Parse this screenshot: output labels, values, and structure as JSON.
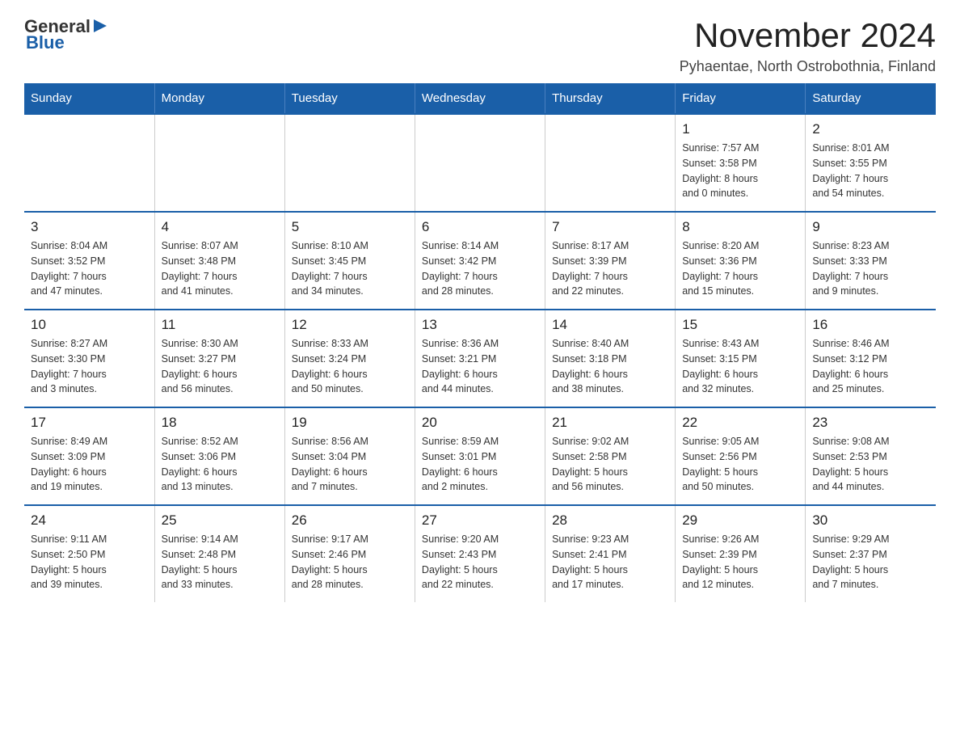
{
  "logo": {
    "text_general": "General",
    "text_blue": "Blue"
  },
  "header": {
    "month_title": "November 2024",
    "location": "Pyhaentae, North Ostrobothnia, Finland"
  },
  "weekdays": [
    "Sunday",
    "Monday",
    "Tuesday",
    "Wednesday",
    "Thursday",
    "Friday",
    "Saturday"
  ],
  "weeks": [
    [
      {
        "day": "",
        "info": ""
      },
      {
        "day": "",
        "info": ""
      },
      {
        "day": "",
        "info": ""
      },
      {
        "day": "",
        "info": ""
      },
      {
        "day": "",
        "info": ""
      },
      {
        "day": "1",
        "info": "Sunrise: 7:57 AM\nSunset: 3:58 PM\nDaylight: 8 hours\nand 0 minutes."
      },
      {
        "day": "2",
        "info": "Sunrise: 8:01 AM\nSunset: 3:55 PM\nDaylight: 7 hours\nand 54 minutes."
      }
    ],
    [
      {
        "day": "3",
        "info": "Sunrise: 8:04 AM\nSunset: 3:52 PM\nDaylight: 7 hours\nand 47 minutes."
      },
      {
        "day": "4",
        "info": "Sunrise: 8:07 AM\nSunset: 3:48 PM\nDaylight: 7 hours\nand 41 minutes."
      },
      {
        "day": "5",
        "info": "Sunrise: 8:10 AM\nSunset: 3:45 PM\nDaylight: 7 hours\nand 34 minutes."
      },
      {
        "day": "6",
        "info": "Sunrise: 8:14 AM\nSunset: 3:42 PM\nDaylight: 7 hours\nand 28 minutes."
      },
      {
        "day": "7",
        "info": "Sunrise: 8:17 AM\nSunset: 3:39 PM\nDaylight: 7 hours\nand 22 minutes."
      },
      {
        "day": "8",
        "info": "Sunrise: 8:20 AM\nSunset: 3:36 PM\nDaylight: 7 hours\nand 15 minutes."
      },
      {
        "day": "9",
        "info": "Sunrise: 8:23 AM\nSunset: 3:33 PM\nDaylight: 7 hours\nand 9 minutes."
      }
    ],
    [
      {
        "day": "10",
        "info": "Sunrise: 8:27 AM\nSunset: 3:30 PM\nDaylight: 7 hours\nand 3 minutes."
      },
      {
        "day": "11",
        "info": "Sunrise: 8:30 AM\nSunset: 3:27 PM\nDaylight: 6 hours\nand 56 minutes."
      },
      {
        "day": "12",
        "info": "Sunrise: 8:33 AM\nSunset: 3:24 PM\nDaylight: 6 hours\nand 50 minutes."
      },
      {
        "day": "13",
        "info": "Sunrise: 8:36 AM\nSunset: 3:21 PM\nDaylight: 6 hours\nand 44 minutes."
      },
      {
        "day": "14",
        "info": "Sunrise: 8:40 AM\nSunset: 3:18 PM\nDaylight: 6 hours\nand 38 minutes."
      },
      {
        "day": "15",
        "info": "Sunrise: 8:43 AM\nSunset: 3:15 PM\nDaylight: 6 hours\nand 32 minutes."
      },
      {
        "day": "16",
        "info": "Sunrise: 8:46 AM\nSunset: 3:12 PM\nDaylight: 6 hours\nand 25 minutes."
      }
    ],
    [
      {
        "day": "17",
        "info": "Sunrise: 8:49 AM\nSunset: 3:09 PM\nDaylight: 6 hours\nand 19 minutes."
      },
      {
        "day": "18",
        "info": "Sunrise: 8:52 AM\nSunset: 3:06 PM\nDaylight: 6 hours\nand 13 minutes."
      },
      {
        "day": "19",
        "info": "Sunrise: 8:56 AM\nSunset: 3:04 PM\nDaylight: 6 hours\nand 7 minutes."
      },
      {
        "day": "20",
        "info": "Sunrise: 8:59 AM\nSunset: 3:01 PM\nDaylight: 6 hours\nand 2 minutes."
      },
      {
        "day": "21",
        "info": "Sunrise: 9:02 AM\nSunset: 2:58 PM\nDaylight: 5 hours\nand 56 minutes."
      },
      {
        "day": "22",
        "info": "Sunrise: 9:05 AM\nSunset: 2:56 PM\nDaylight: 5 hours\nand 50 minutes."
      },
      {
        "day": "23",
        "info": "Sunrise: 9:08 AM\nSunset: 2:53 PM\nDaylight: 5 hours\nand 44 minutes."
      }
    ],
    [
      {
        "day": "24",
        "info": "Sunrise: 9:11 AM\nSunset: 2:50 PM\nDaylight: 5 hours\nand 39 minutes."
      },
      {
        "day": "25",
        "info": "Sunrise: 9:14 AM\nSunset: 2:48 PM\nDaylight: 5 hours\nand 33 minutes."
      },
      {
        "day": "26",
        "info": "Sunrise: 9:17 AM\nSunset: 2:46 PM\nDaylight: 5 hours\nand 28 minutes."
      },
      {
        "day": "27",
        "info": "Sunrise: 9:20 AM\nSunset: 2:43 PM\nDaylight: 5 hours\nand 22 minutes."
      },
      {
        "day": "28",
        "info": "Sunrise: 9:23 AM\nSunset: 2:41 PM\nDaylight: 5 hours\nand 17 minutes."
      },
      {
        "day": "29",
        "info": "Sunrise: 9:26 AM\nSunset: 2:39 PM\nDaylight: 5 hours\nand 12 minutes."
      },
      {
        "day": "30",
        "info": "Sunrise: 9:29 AM\nSunset: 2:37 PM\nDaylight: 5 hours\nand 7 minutes."
      }
    ]
  ]
}
